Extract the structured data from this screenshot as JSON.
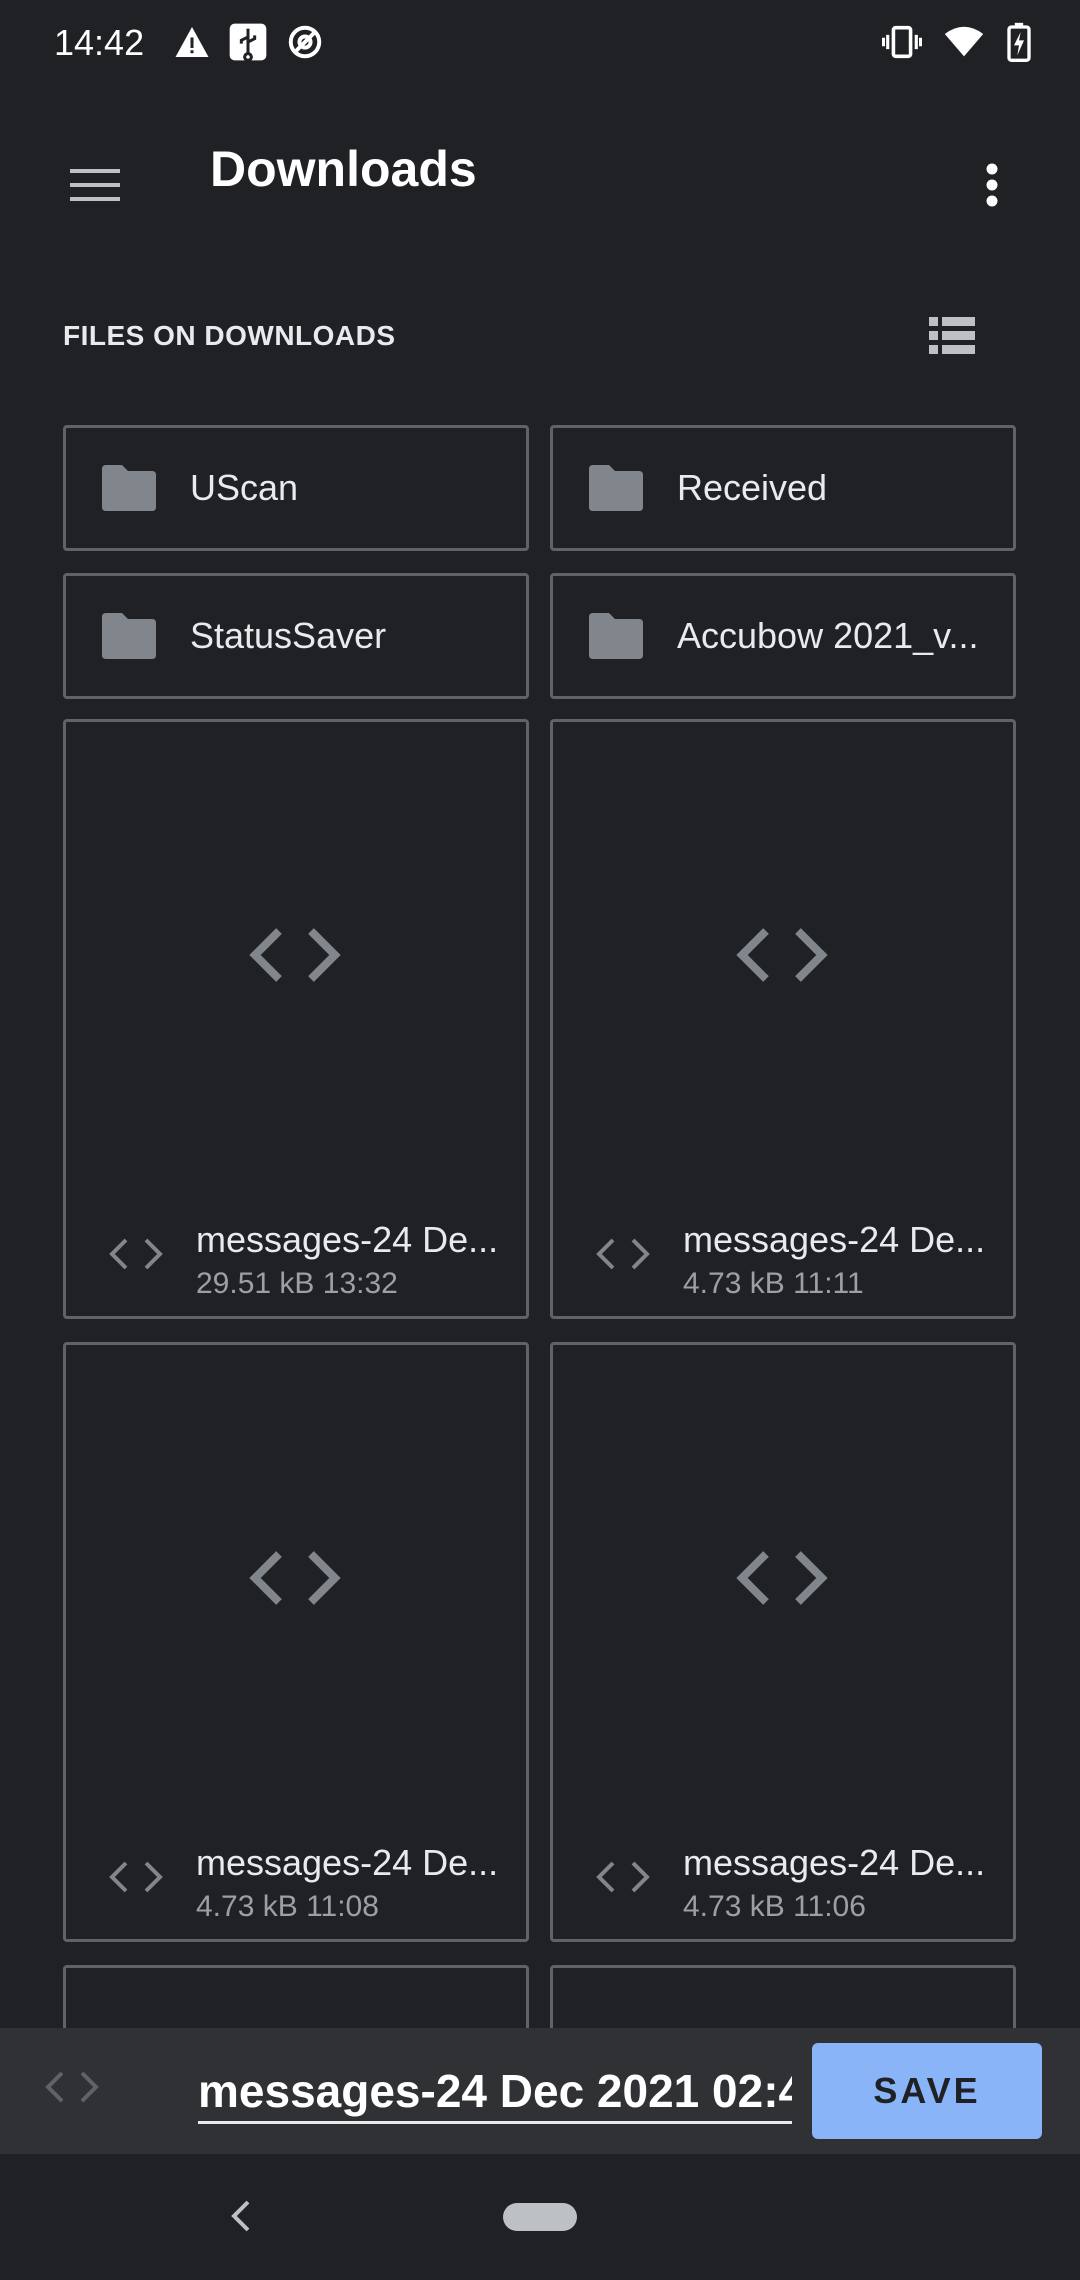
{
  "status_bar": {
    "time": "14:42",
    "left_icons": [
      "warning-icon",
      "usb-icon",
      "data-saver-icon"
    ],
    "right_icons": [
      "vibrate-icon",
      "wifi-icon",
      "battery-charging-icon"
    ]
  },
  "app_bar": {
    "title": "Downloads",
    "menu_icon": "hamburger-menu-icon",
    "more_icon": "more-vert-icon"
  },
  "section": {
    "label": "FILES ON DOWNLOADS",
    "view_toggle_icon": "list-view-icon"
  },
  "folders": [
    {
      "name": "UScan"
    },
    {
      "name": "Received"
    },
    {
      "name": "StatusSaver"
    },
    {
      "name": "Accubow 2021_v..."
    }
  ],
  "files": [
    {
      "name": "messages-24 De...",
      "size": "29.51 kB",
      "time": "13:32",
      "meta": "29.51 kB 13:32"
    },
    {
      "name": "messages-24 De...",
      "size": "4.73 kB",
      "time": "11:11",
      "meta": "4.73 kB 11:11"
    },
    {
      "name": "messages-24 De...",
      "size": "4.73 kB",
      "time": "11:08",
      "meta": "4.73 kB 11:08"
    },
    {
      "name": "messages-24 De...",
      "size": "4.73 kB",
      "time": "11:06",
      "meta": "4.73 kB 11:06"
    }
  ],
  "save_bar": {
    "filename_value": "messages-24 Dec 2021 02:4",
    "save_label": "SAVE"
  },
  "colors": {
    "background": "#202124",
    "tile_border": "#5f6368",
    "accent": "#8ab4f8"
  }
}
